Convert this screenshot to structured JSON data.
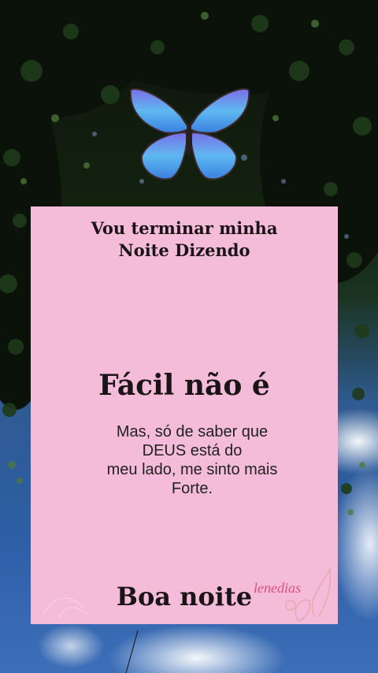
{
  "card": {
    "title_line1": "Vou terminar minha",
    "title_line2": "Noite Dizendo",
    "heading": "Fácil não é",
    "body_line1": "Mas, só de saber que",
    "body_line2": "DEUS está do",
    "body_line3": "meu lado, me sinto mais",
    "body_line4": "Forte.",
    "footer": "Boa noite",
    "signature": "lenedias"
  },
  "colors": {
    "card_background": "#f4bcd9",
    "text": "#1a1416",
    "signature": "#e0507a",
    "butterfly_wing": "#5fb8f0"
  },
  "icons": [
    "butterfly-icon",
    "flower-outline-icon"
  ]
}
